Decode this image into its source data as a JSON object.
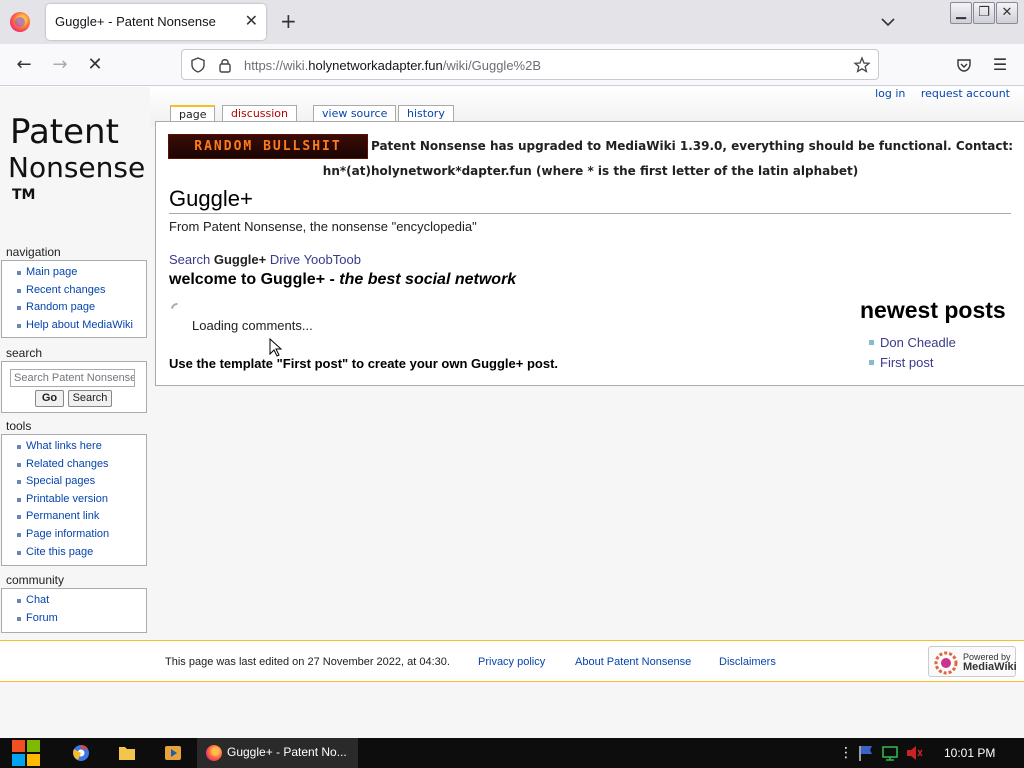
{
  "browser": {
    "tab_title": "Guggle+ - Patent Nonsense",
    "url_prefix": "https://wiki.",
    "url_host": "holynetworkadapter.fun",
    "url_path": "/wiki/Guggle%2B"
  },
  "wiki": {
    "logo_text": [
      "Patent",
      "Nonsense",
      "TM"
    ],
    "personal": {
      "login": "log in",
      "request": "request account"
    },
    "tabs": [
      "page",
      "discussion",
      "view source",
      "history"
    ],
    "banner_text": "RANDOM BULLSHIT",
    "notice_line1": "Patent Nonsense has upgraded to MediaWiki 1.39.0, everything should be functional. Contact:",
    "notice_line2": "hn*(at)holynetwork*dapter.fun (where * is the first letter of the latin alphabet)",
    "title": "Guggle+",
    "subtitle": "From Patent Nonsense, the nonsense \"encyclopedia\"",
    "search_line": {
      "search": "Search",
      "current": "Guggle+",
      "drive": "Drive",
      "yoobtoob": "YoobToob"
    },
    "welcome_bold": "welcome to Guggle+ - ",
    "welcome_italic": "the best social network",
    "loading": "Loading comments...",
    "template_note": "Use the template \"First post\" to create your own Guggle+ post.",
    "newest": {
      "title": "newest posts",
      "items": [
        "Don Cheadle",
        "First post"
      ]
    }
  },
  "sidebar": {
    "navigation": {
      "heading": "navigation",
      "items": [
        "Main page",
        "Recent changes",
        "Random page",
        "Help about MediaWiki"
      ]
    },
    "search": {
      "heading": "search",
      "placeholder": "Search Patent Nonsense",
      "go": "Go",
      "search": "Search"
    },
    "tools": {
      "heading": "tools",
      "items": [
        "What links here",
        "Related changes",
        "Special pages",
        "Printable version",
        "Permanent link",
        "Page information",
        "Cite this page"
      ]
    },
    "community": {
      "heading": "community",
      "items": [
        "Chat",
        "Forum"
      ]
    }
  },
  "footer": {
    "last_edited": "This page was last edited on 27 November 2022, at 04:30.",
    "privacy": "Privacy policy",
    "about": "About Patent Nonsense",
    "disclaimers": "Disclaimers",
    "powered_small": "Powered by",
    "powered_big": "MediaWiki"
  },
  "taskbar": {
    "app_label": "Guggle+ - Patent No...",
    "clock": "10:01 PM"
  },
  "colors": {
    "accent": "#fabd23",
    "link": "#0645ad",
    "taskbar": "#0d0d0d"
  }
}
